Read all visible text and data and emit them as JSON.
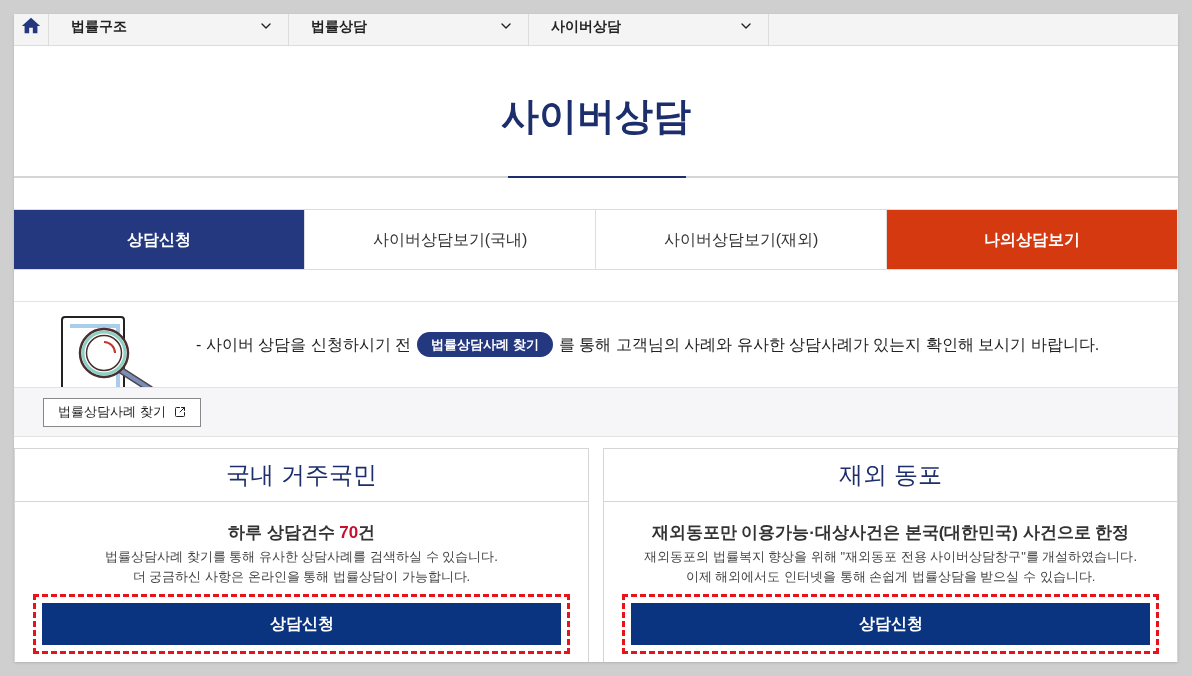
{
  "nav": {
    "menus": [
      {
        "label": "법률구조"
      },
      {
        "label": "법률상담"
      },
      {
        "label": "사이버상담"
      }
    ]
  },
  "page_title": "사이버상담",
  "tabs": [
    {
      "label": "상담신청",
      "selected": true,
      "kind": "normal"
    },
    {
      "label": "사이버상담보기(국내)",
      "selected": false,
      "kind": "normal"
    },
    {
      "label": "사이버상담보기(재외)",
      "selected": false,
      "kind": "normal"
    },
    {
      "label": "나의상담보기",
      "selected": false,
      "kind": "accent"
    }
  ],
  "notice": {
    "text_before": "- 사이버 상담을 신청하시기 전",
    "link": "법률상담사례 찾기",
    "text_after": "를 통해 고객님의 사례와 유사한 상담사례가 있는지 확인해 보시기 바랍니다."
  },
  "case_search_button": "법률상담사례 찾기",
  "cards": [
    {
      "title": "국내 거주국민",
      "headline": {
        "before": "하루 상담건수 ",
        "number": "70",
        "after": "건"
      },
      "lines": [
        "법률상담사례 찾기를 통해 유사한 상담사례를 검색하실 수 있습니다.",
        "더 궁금하신 사항은 온라인을 통해 법률상담이 가능합니다."
      ],
      "button": "상담신청",
      "highlighted": true
    },
    {
      "title": "재외 동포",
      "headline": {
        "before": "재외동포만 이용가능·대상사건은 본국(대한민국) 사건으로 한정"
      },
      "lines": [
        "재외동포의 법률복지 향상을 위해 \"재외동포 전용 사이버상담창구\"를 개설하였습니다.",
        "이제 해외에서도 인터넷을 통해 손쉽게 법률상담을 받으실 수 있습니다."
      ],
      "button": "상담신청",
      "highlighted": true
    }
  ]
}
